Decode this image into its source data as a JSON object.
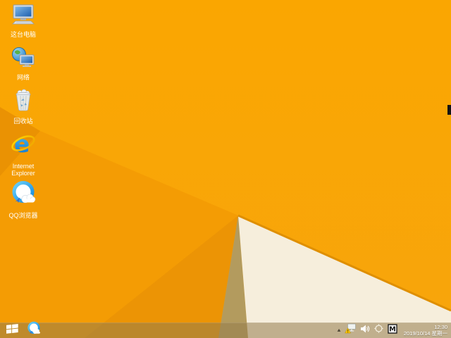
{
  "desktop": {
    "icons": [
      {
        "id": "this-pc",
        "label": "这台电脑"
      },
      {
        "id": "network",
        "label": "网络"
      },
      {
        "id": "recycle-bin",
        "label": "回收站"
      },
      {
        "id": "internet-explorer",
        "label": "Internet Explorer"
      },
      {
        "id": "qq-browser",
        "label": "QQ浏览器"
      }
    ]
  },
  "taskbar": {
    "pinned": [
      {
        "id": "qq-browser-taskbar"
      }
    ],
    "tray": {
      "show_hidden_glyph": "▴",
      "icon_names": [
        "network-warning-icon",
        "volume-icon",
        "language-indicator-icon",
        "ime-mode-box"
      ],
      "ime_mode": "M",
      "clock": {
        "time": "12:30",
        "date": "2019/10/14 星期一"
      }
    }
  },
  "colors": {
    "wallpaper_top": "#FAA601",
    "wallpaper_bottom": "#F8A50C",
    "facet_left": "#F49C04",
    "facet_left_dark": "#EC9405",
    "corner_wedge": "#EA9203",
    "shadow_wedge": "#B39B5E",
    "cream_facet": "#F6EEDC",
    "gold_edge": "#DF8F01",
    "black_mark": "#141414",
    "taskbar_tint": "#947C4C",
    "ie_blue": "#0A6FCE",
    "qq_blue": "#0F87DD",
    "warning_yellow": "#FFC800"
  }
}
